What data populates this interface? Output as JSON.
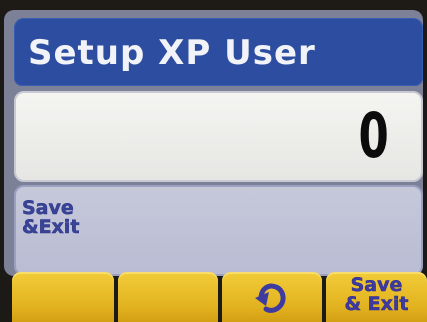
{
  "screen": {
    "title": "Setup XP User",
    "value": "0"
  },
  "menu": {
    "save_exit_label": "Save\n&Exit"
  },
  "softkeys": [
    {
      "label": ""
    },
    {
      "label": ""
    },
    {
      "icon": "undo-icon"
    },
    {
      "label": "Save\n& Exit"
    }
  ],
  "colors": {
    "title_bar": "#2d4ea0",
    "softkey": "#e8bd2a",
    "menu_panel": "#c0c3d8",
    "value_field": "#efefec"
  }
}
